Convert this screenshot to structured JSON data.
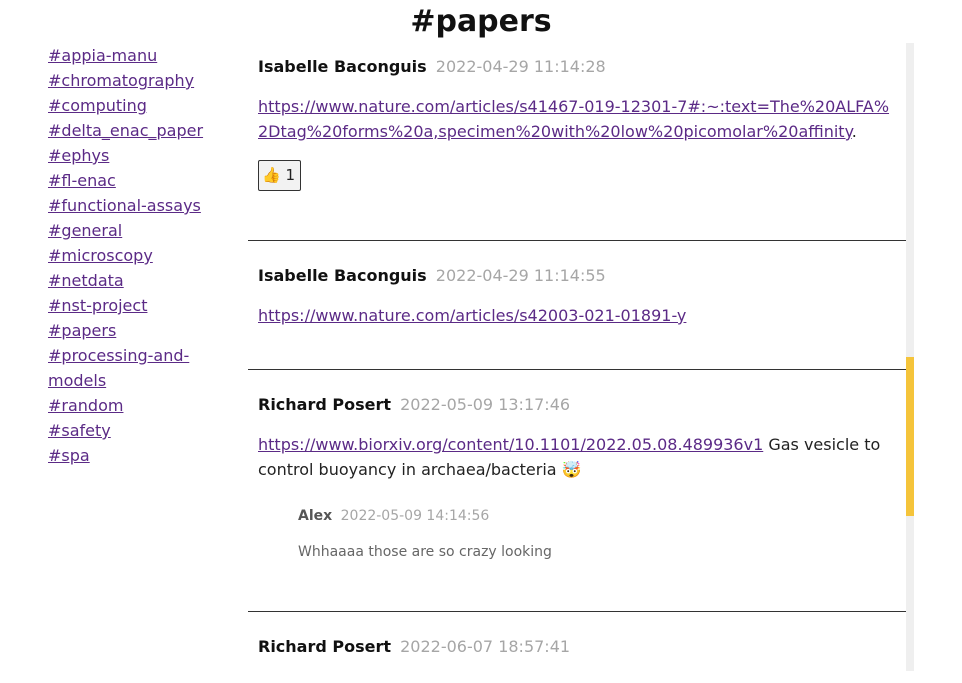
{
  "page": {
    "title": "#papers"
  },
  "sidebar": {
    "channels": [
      "#appia-manu",
      "#chromatography",
      "#computing",
      "#delta_enac_paper",
      "#ephys",
      "#fl-enac",
      "#functional-assays",
      "#general",
      "#microscopy",
      "#netdata",
      "#nst-project",
      "#papers",
      "#processing-and-models",
      "#random",
      "#safety",
      "#spa"
    ]
  },
  "messages": [
    {
      "author": "Isabelle Baconguis",
      "time": "2022-04-29 11:14:28",
      "link": "https://www.nature.com/articles/s41467-019-12301-7#:~:text=The%20ALFA%2Dtag%20forms%20a,specimen%20with%20low%20picomolar%20affinity",
      "text_after": ".",
      "reaction": {
        "emoji": "👍",
        "count": "1"
      }
    },
    {
      "author": "Isabelle Baconguis",
      "time": "2022-04-29 11:14:55",
      "link": "https://www.nature.com/articles/s42003-021-01891-y"
    },
    {
      "author": "Richard Posert",
      "time": "2022-05-09 13:17:46",
      "link": "https://www.biorxiv.org/content/10.1101/2022.05.08.489936v1",
      "text_after": " Gas vesicle to control buoyancy in archaea/bacteria 🤯",
      "reply": {
        "author": "Alex",
        "time": "2022-05-09 14:14:56",
        "text": "Whhaaaa those are so crazy looking"
      }
    },
    {
      "author": "Richard Posert",
      "time": "2022-06-07 18:57:41"
    }
  ],
  "colors": {
    "link": "#5b2a86",
    "scroll_thumb": "#f5c43a",
    "timestamp": "#a6a6a6"
  }
}
